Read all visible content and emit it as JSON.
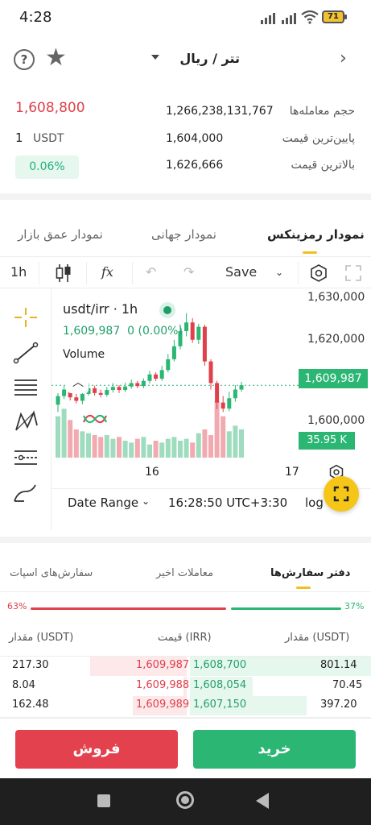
{
  "status_bar": {
    "time": "4:28",
    "battery": "71"
  },
  "header": {
    "pair": "تتر / ریال"
  },
  "stats": {
    "last_price": "1,608,800",
    "unit_amount": "1",
    "unit": "USDT",
    "change": "0.06%",
    "rows": [
      {
        "label": "حجم معامله‌ها",
        "value": "1,266,238,131,767"
      },
      {
        "label": "پایین‌ترین قیمت",
        "value": "1,604,000"
      },
      {
        "label": "بالاترین قیمت",
        "value": "1,626,666"
      }
    ]
  },
  "chart_tabs": {
    "depth": "نمودار عمق بازار",
    "global": "نمودار جهانی",
    "ramzinex": "نمودار رمزینکس"
  },
  "toolbar": {
    "interval": "1h",
    "fx": "fx",
    "save": "Save"
  },
  "chart": {
    "symbol": "usdt/irr · 1h",
    "last": "1,609,987",
    "change": "0 (0.00%)",
    "volume_label": "Volume",
    "price_tag": "1,609,987",
    "volume_tag": "35.95 K",
    "x_labels": [
      "16",
      "17"
    ],
    "date_range": "Date Range",
    "clock": "16:28:50 UTC+3:30",
    "scale": "log",
    "colors": {
      "up": "#2bb673",
      "down": "#e0404a"
    }
  },
  "chart_data": {
    "type": "candlestick",
    "y_ticks": [
      "1,630,000",
      "1,620,000",
      "1,610,000",
      "1,600,000"
    ],
    "ylim": [
      1597000,
      1630500
    ],
    "candles": [
      [
        1605500,
        1607500,
        1603800,
        1608200
      ],
      [
        1607500,
        1609000,
        1606800,
        1609800
      ],
      [
        1609000,
        1607200,
        1606500,
        1609600
      ],
      [
        1607200,
        1606400,
        1605800,
        1608000
      ],
      [
        1606400,
        1608000,
        1605600,
        1608600
      ],
      [
        1608000,
        1609300,
        1607600,
        1610500
      ],
      [
        1609300,
        1608200,
        1607600,
        1609900
      ],
      [
        1608200,
        1607800,
        1607200,
        1609000
      ],
      [
        1607800,
        1608900,
        1607300,
        1609600
      ],
      [
        1608900,
        1609600,
        1608300,
        1610500
      ],
      [
        1609600,
        1608900,
        1608200,
        1610000
      ],
      [
        1608900,
        1609700,
        1608400,
        1610600
      ],
      [
        1609700,
        1610500,
        1609200,
        1611300
      ],
      [
        1610500,
        1609800,
        1609300,
        1611000
      ],
      [
        1609800,
        1611000,
        1609300,
        1611600
      ],
      [
        1611000,
        1612500,
        1610400,
        1613300
      ],
      [
        1612500,
        1611500,
        1611000,
        1613000
      ],
      [
        1611500,
        1613500,
        1611000,
        1614500
      ],
      [
        1613500,
        1616000,
        1613000,
        1617200
      ],
      [
        1616000,
        1619000,
        1615500,
        1620500
      ],
      [
        1619000,
        1622500,
        1618300,
        1624000
      ],
      [
        1622500,
        1624500,
        1621300,
        1626666
      ],
      [
        1624500,
        1620500,
        1619800,
        1625500
      ],
      [
        1620500,
        1623500,
        1619500,
        1624200
      ],
      [
        1623500,
        1615500,
        1614500,
        1624000
      ],
      [
        1615500,
        1610500,
        1609000,
        1616000
      ],
      [
        1610500,
        1606000,
        1604500,
        1611000
      ],
      [
        1606000,
        1604600,
        1603800,
        1607500
      ],
      [
        1604600,
        1607000,
        1604000,
        1608500
      ],
      [
        1607000,
        1609000,
        1606200,
        1610000
      ],
      [
        1609000,
        1609987,
        1608500,
        1610800
      ]
    ],
    "volumes": [
      44,
      52,
      40,
      30,
      28,
      26,
      24,
      22,
      24,
      20,
      22,
      18,
      16,
      20,
      22,
      14,
      18,
      16,
      20,
      22,
      18,
      20,
      16,
      26,
      30,
      24,
      60,
      44,
      28,
      34,
      30
    ]
  },
  "orderbook": {
    "tabs": {
      "spot": "سفارش‌های اسپات",
      "recent": "معاملات اخیر",
      "book": "دفتر سفارش‌ها"
    },
    "sell_pct": "63%",
    "buy_pct": "37%",
    "sell_ratio": 0.63,
    "headers": {
      "amount_left": "مقدار (USDT)",
      "price": "قیمت (IRR)",
      "amount_right": "مقدار (USDT)"
    },
    "rows": [
      {
        "ask_amount": "217.30",
        "ask_price": "1,609,987",
        "bid_price": "1,608,700",
        "bid_amount": "801.14"
      },
      {
        "ask_amount": "8.04",
        "ask_price": "1,609,988",
        "bid_price": "1,608,054",
        "bid_amount": "70.45"
      },
      {
        "ask_amount": "162.48",
        "ask_price": "1,609,989",
        "bid_price": "1,607,150",
        "bid_amount": "397.20"
      }
    ]
  },
  "actions": {
    "sell": "فروش",
    "buy": "خرید"
  }
}
